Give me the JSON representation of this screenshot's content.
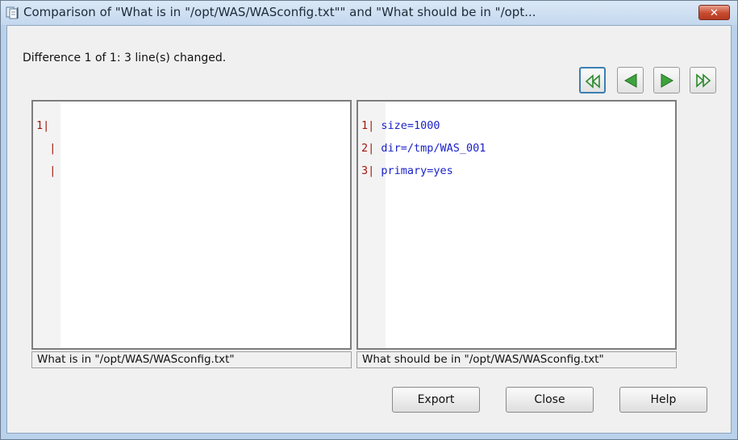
{
  "window": {
    "title": "Comparison of \"What is in \"/opt/WAS/WASconfig.txt\"\" and \"What should be in \"/opt...",
    "close_icon": "close-icon",
    "app_icon": "document-compare-icon"
  },
  "status": {
    "text": "Difference 1 of 1:  3 line(s) changed."
  },
  "navigation": {
    "first": "first-difference-icon",
    "previous": "previous-difference-icon",
    "next": "next-difference-icon",
    "last": "last-difference-icon"
  },
  "left_pane": {
    "lines": [
      {
        "number": "1|",
        "text": ""
      },
      {
        "number": "  |",
        "text": ""
      },
      {
        "number": "  |",
        "text": ""
      }
    ],
    "caption": "What is in \"/opt/WAS/WASconfig.txt\""
  },
  "right_pane": {
    "lines": [
      {
        "number": "1|",
        "text": " size=1000"
      },
      {
        "number": "2|",
        "text": " dir=/tmp/WAS_001"
      },
      {
        "number": "3|",
        "text": " primary=yes"
      }
    ],
    "caption": "What should be in \"/opt/WAS/WASconfig.txt\""
  },
  "buttons": {
    "export": "Export",
    "close": "Close",
    "help": "Help"
  },
  "colors": {
    "line_number": "#a1170e",
    "added_text": "#1a22c8",
    "title_bar": "#c3d8ee"
  }
}
